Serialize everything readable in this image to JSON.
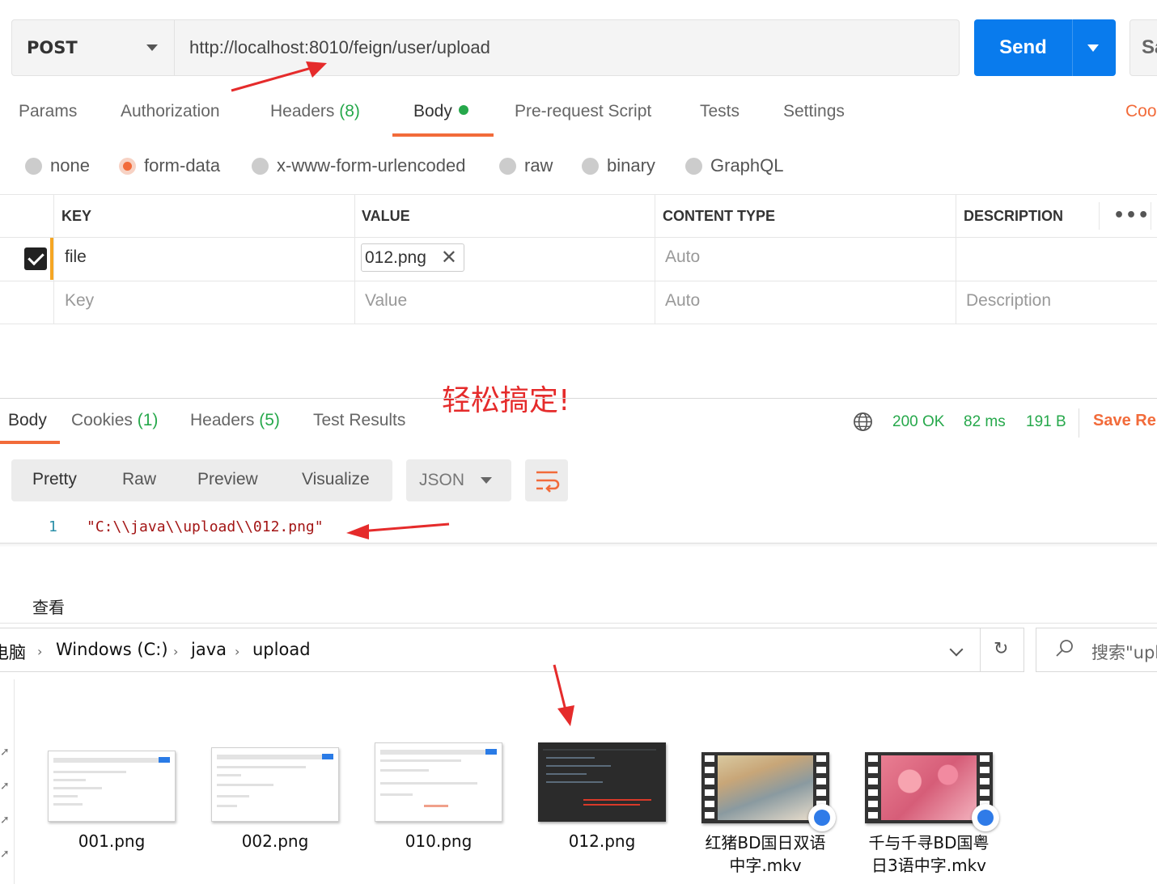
{
  "request": {
    "method": "POST",
    "url": "http://localhost:8010/feign/user/upload",
    "send_label": "Send",
    "save_label": "Sa",
    "tabs": [
      {
        "label": "Params",
        "count": ""
      },
      {
        "label": "Authorization",
        "count": ""
      },
      {
        "label": "Headers",
        "count": "(8)"
      },
      {
        "label": "Body",
        "count": ""
      },
      {
        "label": "Pre-request Script",
        "count": ""
      },
      {
        "label": "Tests",
        "count": ""
      },
      {
        "label": "Settings",
        "count": ""
      }
    ],
    "active_tab": "Body",
    "cookies_link": "Coo",
    "body_types": [
      "none",
      "form-data",
      "x-www-form-urlencoded",
      "raw",
      "binary",
      "GraphQL"
    ],
    "selected_body_type": "form-data",
    "table": {
      "headers": [
        "KEY",
        "VALUE",
        "CONTENT TYPE",
        "DESCRIPTION"
      ],
      "rows": [
        {
          "checked": true,
          "key": "file",
          "value": "012.png",
          "content_type": "Auto",
          "description": ""
        }
      ],
      "placeholder": {
        "key": "Key",
        "value": "Value",
        "content_type": "Auto",
        "description": "Description"
      }
    }
  },
  "annotation": "轻松搞定!",
  "response": {
    "tabs": [
      {
        "label": "Body",
        "count": ""
      },
      {
        "label": "Cookies",
        "count": "(1)"
      },
      {
        "label": "Headers",
        "count": "(5)"
      },
      {
        "label": "Test Results",
        "count": ""
      }
    ],
    "status": "200 OK",
    "time": "82 ms",
    "size": "191 B",
    "save_label": "Save Re",
    "view_modes": [
      "Pretty",
      "Raw",
      "Preview",
      "Visualize"
    ],
    "format": "JSON",
    "lines": [
      {
        "num": "1",
        "text": "\"C:\\\\java\\\\upload\\\\012.png\""
      }
    ]
  },
  "explorer": {
    "ribbon_label": "查看",
    "breadcrumb": [
      "电脑",
      "Windows (C:)",
      "java",
      "upload"
    ],
    "search_placeholder": "搜索\"upl",
    "files": [
      {
        "name": "001.png",
        "type": "image"
      },
      {
        "name": "002.png",
        "type": "image"
      },
      {
        "name": "010.png",
        "type": "image"
      },
      {
        "name": "012.png",
        "type": "image-dark"
      },
      {
        "name": "红猪BD国日双语中字.mkv",
        "line1": "红猪BD国日双语",
        "line2": "中字.mkv",
        "type": "video"
      },
      {
        "name": "千与千寻BD国粤日3语中字.mkv",
        "line1": "千与千寻BD国粤",
        "line2": "日3语中字.mkv",
        "type": "video"
      }
    ]
  },
  "colors": {
    "accent": "#f26b3a",
    "send": "#097bed",
    "ok": "#26a84b",
    "annotation": "#e52b2b"
  }
}
